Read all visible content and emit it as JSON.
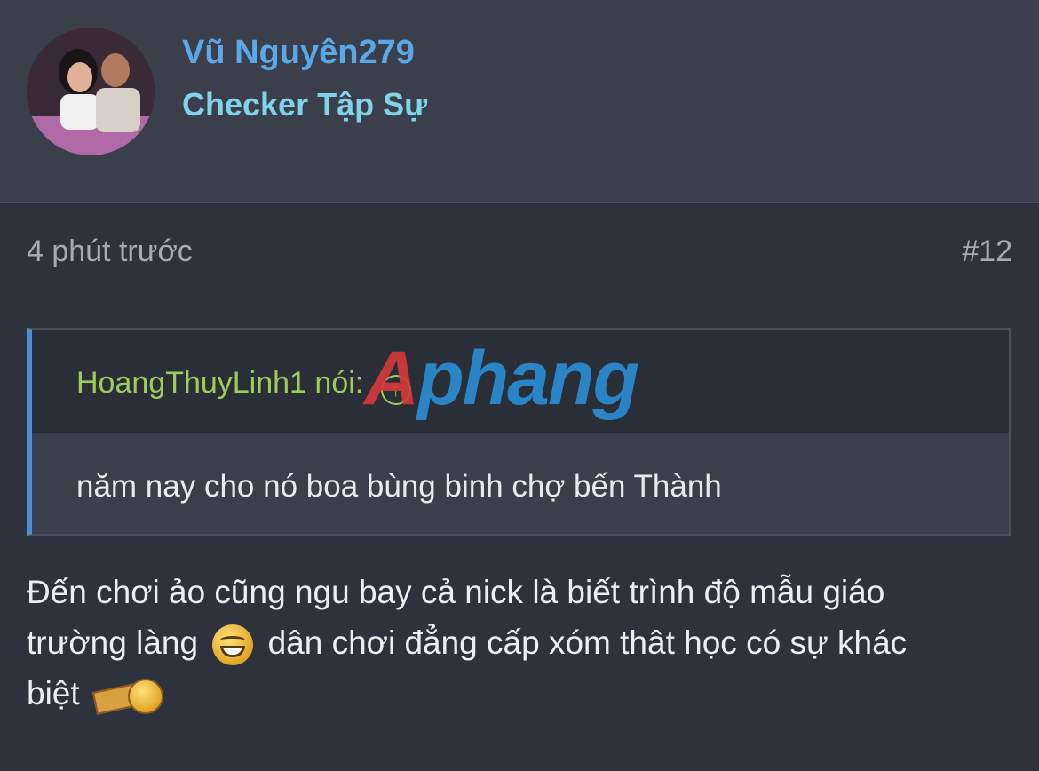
{
  "post": {
    "author": {
      "name": "Vũ Nguyên279",
      "title": "Checker Tập Sự"
    },
    "time": "4 phút trước",
    "number": "#12",
    "quote": {
      "author": "HoangThuyLinh1",
      "said": "nói:",
      "jump_icon": "arrow-up-circle-icon",
      "text": "năm nay cho nó boa bùng binh chợ bến Thành"
    },
    "body": {
      "line1": "Đến chơi ảo cũng ngu bay cả nick là biết trình độ mẫu giáo",
      "line2_start": "trường làng",
      "line2_end": "dân chơi đẳng cấp xóm thât học có sự khác",
      "line3": "biệt"
    }
  },
  "watermark": {
    "first": "A",
    "rest": "phang"
  },
  "colors": {
    "background": "#2e323d",
    "username": "#5aa8e8",
    "user_title": "#7fd4e8",
    "quote_author": "#9ccc5a",
    "quote_bar": "#4a8fd6"
  }
}
